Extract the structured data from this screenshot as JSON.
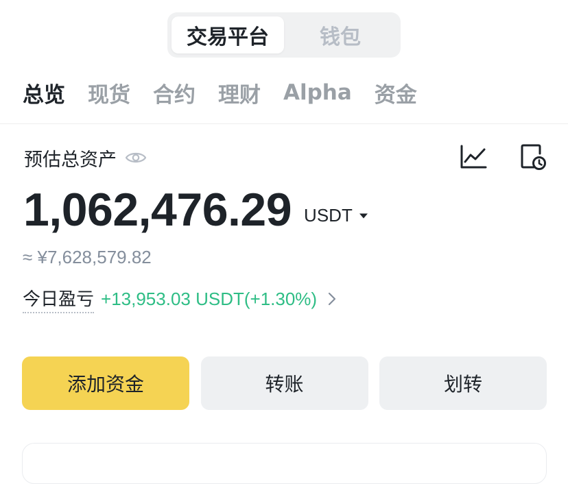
{
  "segment": {
    "items": [
      "交易平台",
      "钱包"
    ],
    "active": 0
  },
  "tabs": {
    "items": [
      "总览",
      "现货",
      "合约",
      "理财",
      "Alpha",
      "资金"
    ],
    "active": 0
  },
  "assets": {
    "label": "预估总资产",
    "balance": "1,062,476.29",
    "unit": "USDT",
    "fiat": "≈ ¥7,628,579.82"
  },
  "pnl": {
    "label": "今日盈亏",
    "value": "+13,953.03 USDT(+1.30%)"
  },
  "actions": {
    "add_funds": "添加资金",
    "transfer": "转账",
    "internal_transfer": "划转"
  },
  "icons": {
    "visibility": "eye-icon",
    "chart": "line-chart-icon",
    "history": "history-icon",
    "dropdown": "caret-down-icon",
    "details": "chevron-right-icon"
  },
  "colors": {
    "primary_button": "#f5d353",
    "secondary_button": "#eef0f2",
    "profit": "#2ebd85",
    "muted_text": "#848e9c",
    "text": "#1e2329"
  }
}
